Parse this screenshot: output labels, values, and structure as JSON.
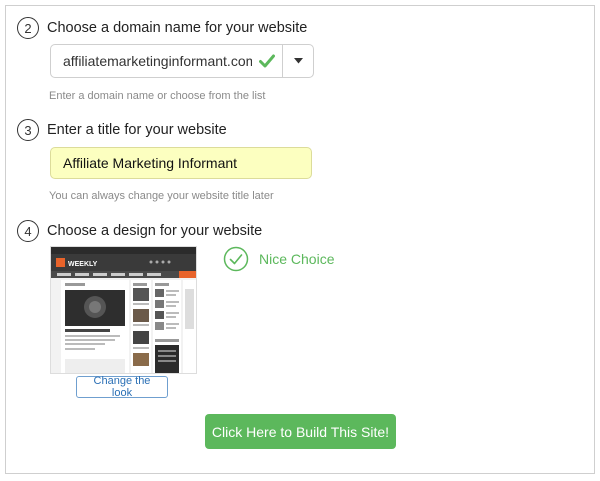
{
  "step2": {
    "number": "2",
    "title": "Choose a domain name for your website",
    "domain_value": "affiliatemarketinginformant.com",
    "help": "Enter a domain name or choose from the list"
  },
  "step3": {
    "number": "3",
    "title": "Enter a title for your website",
    "title_value": "Affiliate Marketing Informant",
    "help": "You can always change your website title later"
  },
  "step4": {
    "number": "4",
    "title": "Choose a design for your website",
    "thumbnail_logo": "WEEKLY",
    "status": "Nice Choice",
    "change_button": "Change the look"
  },
  "build_button": "Click Here to Build This Site!",
  "colors": {
    "success_green": "#5cb85c",
    "link_blue": "#2a6fb5",
    "title_field_bg": "#fcffc0",
    "thumbnail_accent": "#e8632a"
  }
}
